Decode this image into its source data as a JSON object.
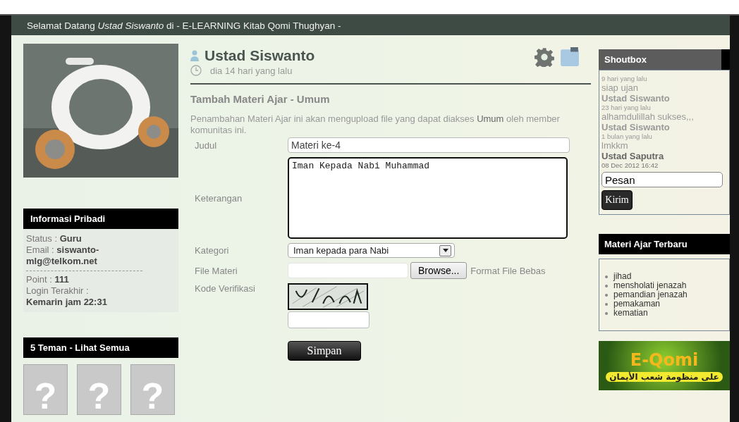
{
  "header": {
    "title": "Selamat Datang *Ustad Siswanto* di - E-LEARNING Kitab Qomi Thughyan -"
  },
  "sidebar": {
    "info": {
      "title": "Informasi Pribadi",
      "lines": [
        "Status : **Guru**",
        "Email : **siswanto-mlg@telkom.net**"
      ],
      "lines_2": [
        "Point : **111**",
        "Login Terakhir :",
        "**Kemarin jam 22:31**"
      ]
    },
    "friends": {
      "title": "5 Teman - Lihat Semua",
      "items": [
        "?",
        "?",
        "?"
      ]
    }
  },
  "profile": {
    "name": "Ustad Siswanto",
    "time": "dia 14 hari yang lalu"
  },
  "form": {
    "title": "Tambah Materi Ajar - Umum",
    "description": "Penambahan Materi Ajar ini akan mengupload file yang dapat diakses **Umum** oleh member komunitas ini.",
    "judul": {
      "label": "Judul",
      "value": "Materi ke-4"
    },
    "keterangan": {
      "label": "Keterangan",
      "value": "Iman Kepada Nabi Muhammad"
    },
    "kategori": {
      "label": "Kategori",
      "value": "Iman kepada para Nabi"
    },
    "file": {
      "label": "File Materi",
      "button": "Browse...",
      "note": "Format File Bebas"
    },
    "kode": {
      "label": "Kode Verifikasi"
    },
    "submit": "Simpan"
  },
  "shoutbox": {
    "title": "Shoutbox",
    "lines": [
      {
        "kind": "time",
        "text": "9 hari yang lalu"
      },
      {
        "kind": "message",
        "text": "siap ujan"
      },
      {
        "kind": "author",
        "text": "Ustad Siswanto"
      },
      {
        "kind": "time",
        "text": "23 hari yang lalu"
      },
      {
        "kind": "message",
        "text": "alhamdulillah sukses,,,"
      },
      {
        "kind": "author",
        "text": "Ustad Siswanto"
      },
      {
        "kind": "time",
        "text": "1 bulan yang lalu"
      },
      {
        "kind": "message",
        "text": "lmkkm"
      },
      {
        "kind": "author",
        "text": "Ustad Saputra"
      },
      {
        "kind": "time",
        "text": "08 Dec 2012 16:42"
      }
    ],
    "input": "Pesan",
    "button": "Kirim"
  },
  "latest": {
    "title": "Materi Ajar Terbaru",
    "items": [
      "jihad",
      "mensholati jenazah",
      "pemandian jenazah",
      "pemakaman",
      "kematian"
    ]
  },
  "banner": {
    "logo": "E-Qomi",
    "tagline": "على منظومة شعب الأيمان"
  }
}
